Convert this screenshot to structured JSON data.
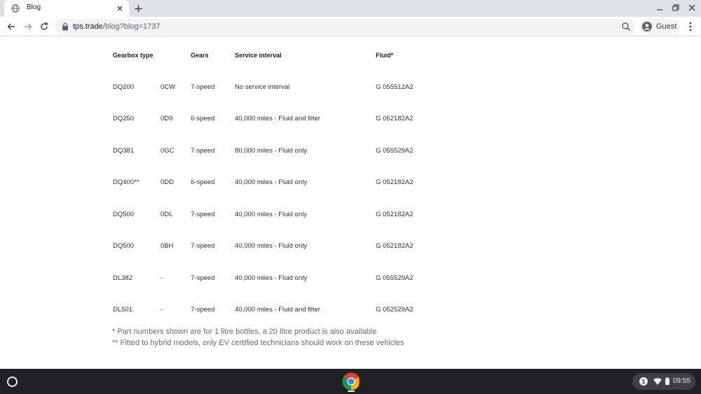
{
  "browser": {
    "tab_title": "Blog",
    "url_host": "tps.trade",
    "url_path": "/blog?blog=1737",
    "profile_label": "Guest"
  },
  "table": {
    "headers": {
      "gearbox_type": "Gearbox type",
      "gears": "Gears",
      "service_interval": "Service interval",
      "fluid": "Fluid*"
    },
    "rows": [
      {
        "gearbox": "DQ200",
        "code": "0CW",
        "gears": "7-speed",
        "interval": "No service interval",
        "fluid": "G 055512A2"
      },
      {
        "gearbox": "DQ250",
        "code": "0D9",
        "gears": "6-speed",
        "interval": "40,000 miles - Fluid and filter",
        "fluid": "G 052182A2"
      },
      {
        "gearbox": "DQ381",
        "code": "0GC",
        "gears": "7-speed",
        "interval": "80,000 miles - Fluid only",
        "fluid": "G 055529A2"
      },
      {
        "gearbox": "DQ400**",
        "code": "0DD",
        "gears": "6-speed",
        "interval": "40,000 miles - Fluid only",
        "fluid": "G 052182A2"
      },
      {
        "gearbox": "DQ500",
        "code": "0DL",
        "gears": "7-speed",
        "interval": "40,000 miles - Fluid only",
        "fluid": "G 052182A2"
      },
      {
        "gearbox": "DQ500",
        "code": "0BH",
        "gears": "7-speed",
        "interval": "40,000 miles - Fluid only",
        "fluid": "G 052182A2"
      },
      {
        "gearbox": "DL382",
        "code": "-",
        "gears": "7-speed",
        "interval": "40,000 miles - Fluid only",
        "fluid": "G 055529A2"
      },
      {
        "gearbox": "DL501",
        "code": "-",
        "gears": "7-speed",
        "interval": "40,000 miles - Fluid and filter",
        "fluid": "G 052529A2"
      }
    ]
  },
  "footnotes": [
    "* Part numbers shown are for 1 litre bottles, a 20 litre product is also available",
    "** Fitted to hybrid models, only EV certified technicians should work on these vehicles"
  ],
  "shelf": {
    "notification_count": "1",
    "time": "09:55"
  },
  "icons": {
    "tab_favicon": "globe-icon",
    "close": "close-icon",
    "new_tab": "plus-icon",
    "back": "back-arrow-icon",
    "forward": "forward-arrow-icon",
    "reload": "reload-icon",
    "lock": "lock-icon",
    "zoom": "zoom-icon",
    "profile": "avatar-icon",
    "menu": "kebab-menu-icon",
    "launcher": "launcher-icon",
    "chrome": "chrome-icon",
    "wifi": "wifi-icon",
    "battery": "battery-icon"
  },
  "colors": {
    "tabstrip_bg": "#dee1e6",
    "shelf_bg": "#202124",
    "text": "#333333",
    "footnote": "#6b6b6b"
  }
}
